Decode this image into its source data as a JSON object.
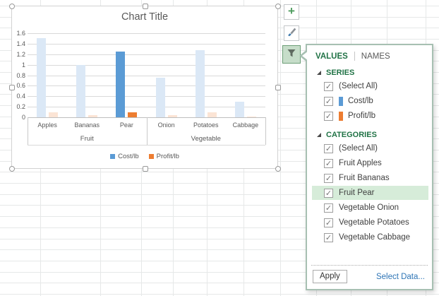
{
  "chart_data": {
    "type": "bar",
    "title": "Chart Title",
    "categories": [
      "Apples",
      "Bananas",
      "Pear",
      "Onion",
      "Potatoes",
      "Cabbage"
    ],
    "group_labels": [
      "Fruit",
      "Vegetable"
    ],
    "category_groups": [
      "Fruit",
      "Fruit",
      "Fruit",
      "Vegetable",
      "Vegetable",
      "Vegetable"
    ],
    "series": [
      {
        "name": "Cost/lb",
        "color": "#5b9bd5",
        "faded_color": "#dbe8f6",
        "values": [
          1.5,
          1.0,
          1.25,
          0.75,
          1.28,
          0.3
        ]
      },
      {
        "name": "Profit/lb",
        "color": "#ed7d31",
        "faded_color": "#fbe4d5",
        "values": [
          0.1,
          0.04,
          0.09,
          0.04,
          0.1,
          0.02
        ]
      }
    ],
    "highlighted_category": "Pear",
    "ylim": [
      0,
      1.6
    ],
    "ytick_step": 0.2,
    "ytick_labels": [
      "0",
      "0.2",
      "0.4",
      "0.6",
      "0.8",
      "1",
      "1.2",
      "1.4",
      "1.6"
    ],
    "grid": true,
    "legend_position": "bottom"
  },
  "chart_tools": {
    "add_button": "+",
    "style_button": "chart-styles",
    "filter_button": "chart-filters"
  },
  "filter_panel": {
    "tabs": [
      {
        "label": "VALUES",
        "active": true
      },
      {
        "label": "NAMES",
        "active": false
      }
    ],
    "series_section": {
      "header": "SERIES",
      "items": [
        {
          "label": "(Select All)",
          "checked": true
        },
        {
          "label": "Cost/lb",
          "checked": true,
          "swatch": "#5b9bd5"
        },
        {
          "label": "Profit/lb",
          "checked": true,
          "swatch": "#ed7d31"
        }
      ]
    },
    "categories_section": {
      "header": "CATEGORIES",
      "items": [
        {
          "label": "(Select All)",
          "checked": true
        },
        {
          "label": "Fruit Apples",
          "checked": true
        },
        {
          "label": "Fruit Bananas",
          "checked": true
        },
        {
          "label": "Fruit Pear",
          "checked": true,
          "highlighted": true
        },
        {
          "label": "Vegetable Onion",
          "checked": true
        },
        {
          "label": "Vegetable Potatoes",
          "checked": true
        },
        {
          "label": "Vegetable Cabbage",
          "checked": true
        }
      ]
    },
    "apply_label": "Apply",
    "select_data_label": "Select Data...",
    "check_glyph": "✓"
  },
  "colors": {
    "excel_green": "#217346",
    "panel_border": "#a7c0b2",
    "highlight_row": "#d6ecd9",
    "link_blue": "#2e75b6",
    "series_blue": "#5b9bd5",
    "series_orange": "#ed7d31",
    "faded_blue": "#dbe8f6",
    "faded_orange": "#fbe4d5"
  }
}
